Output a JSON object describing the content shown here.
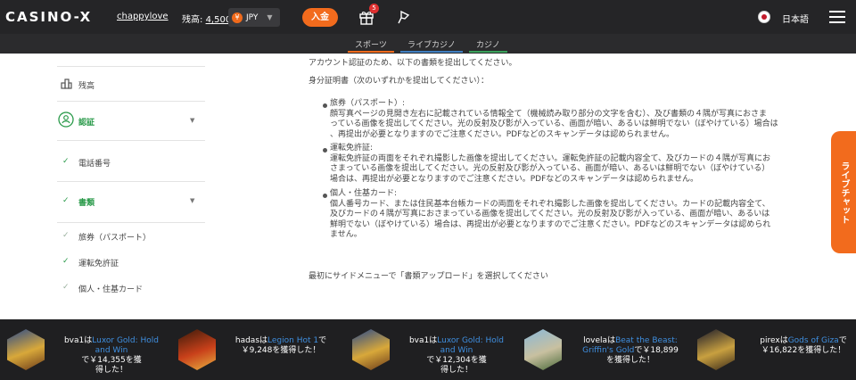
{
  "header": {
    "logo": "CASINO-X",
    "username": "chappylove",
    "balance_label": "残高:",
    "balance_amount": "4,500",
    "currency_symbol": "¥",
    "currency": "JPY",
    "deposit_label": "入金",
    "gift_badge": "5",
    "language": "日本語"
  },
  "subnav": {
    "tabs": [
      "スポーツ",
      "ライブカジノ",
      "カジノ"
    ]
  },
  "sidebar": {
    "balance": "残高",
    "verification": "認証",
    "phone": "電話番号",
    "documents": "書類",
    "passport": "旅券（パスポート）",
    "license": "運転免許証",
    "id_card": "個人・住基カード"
  },
  "content": {
    "intro": "アカウント認証のため、以下の書類を提出してください。",
    "id_heading": "身分証明書（次のいずれかを提出してください）：",
    "docs": [
      {
        "title": "旅券（パスポート）:",
        "lines": [
          "顔写真ページの見開き左右に記載されている情報全て（機械読み取り部分の文字を含む）、及び書類の４隅が写真におさま",
          "っている画像を提出してください。光の反射及び影が入っている、画面が暗い、あるいは鮮明でない（ぼやけている）場合は",
          "、再提出が必要となりますのでご注意ください。PDFなどのスキャンデータは認められません。"
        ]
      },
      {
        "title": "運転免許証:",
        "lines": [
          "運転免許証の両面をそれぞれ撮影した画像を提出してください。運転免許証の記載内容全て、及びカードの４隅が写真にお",
          "さまっている画像を提出してください。光の反射及び影が入っている、画面が暗い、あるいは鮮明でない（ぼやけている）",
          "場合は、再提出が必要となりますのでご注意ください。PDFなどのスキャンデータは認められません。"
        ]
      },
      {
        "title": "個人・住基カード:",
        "lines": [
          "個人番号カード、または住民基本台帳カードの両面をそれぞれ撮影した画像を提出してください。カードの記載内容全て、",
          "及びカードの４隅が写真におさまっている画像を提出してください。光の反射及び影が入っている、画面が暗い、あるいは",
          "鮮明でない（ぼやけている）場合は、再提出が必要となりますのでご注意ください。PDFなどのスキャンデータは認められ",
          "ません。"
        ]
      }
    ],
    "instruction": "最初にサイドメニューで「書類アップロード」を選択してください"
  },
  "livechat": "ライブチャット",
  "footer_wins": [
    {
      "user": "bva1",
      "mid": "は",
      "game": "Luxor Gold: Hold and Win",
      "line2": "で￥14,355を獲",
      "line3": "得した！"
    },
    {
      "user": "hadas",
      "mid": "は",
      "game": "Legion Hot 1",
      "line2": "で",
      "line3": "￥9,248を獲得した！"
    },
    {
      "user": "bva1",
      "mid": "は",
      "game": "Luxor Gold: Hold and Win",
      "line2": "で￥12,304を獲",
      "line3": "得した！"
    },
    {
      "user": "lovela",
      "mid": "は",
      "game": "Beat the Beast: Griffin's Gold",
      "line2": "で￥18,899",
      "line3": "を獲得した！"
    },
    {
      "user": "pirex",
      "mid": "は",
      "game": "Gods of Giza",
      "line2": "で",
      "line3": "￥16,822を獲得した！"
    }
  ],
  "colors": {
    "accent": "#f26b1d",
    "topbar": "#252527",
    "green": "#2a9a4a",
    "link_blue": "#3f8fe0"
  }
}
